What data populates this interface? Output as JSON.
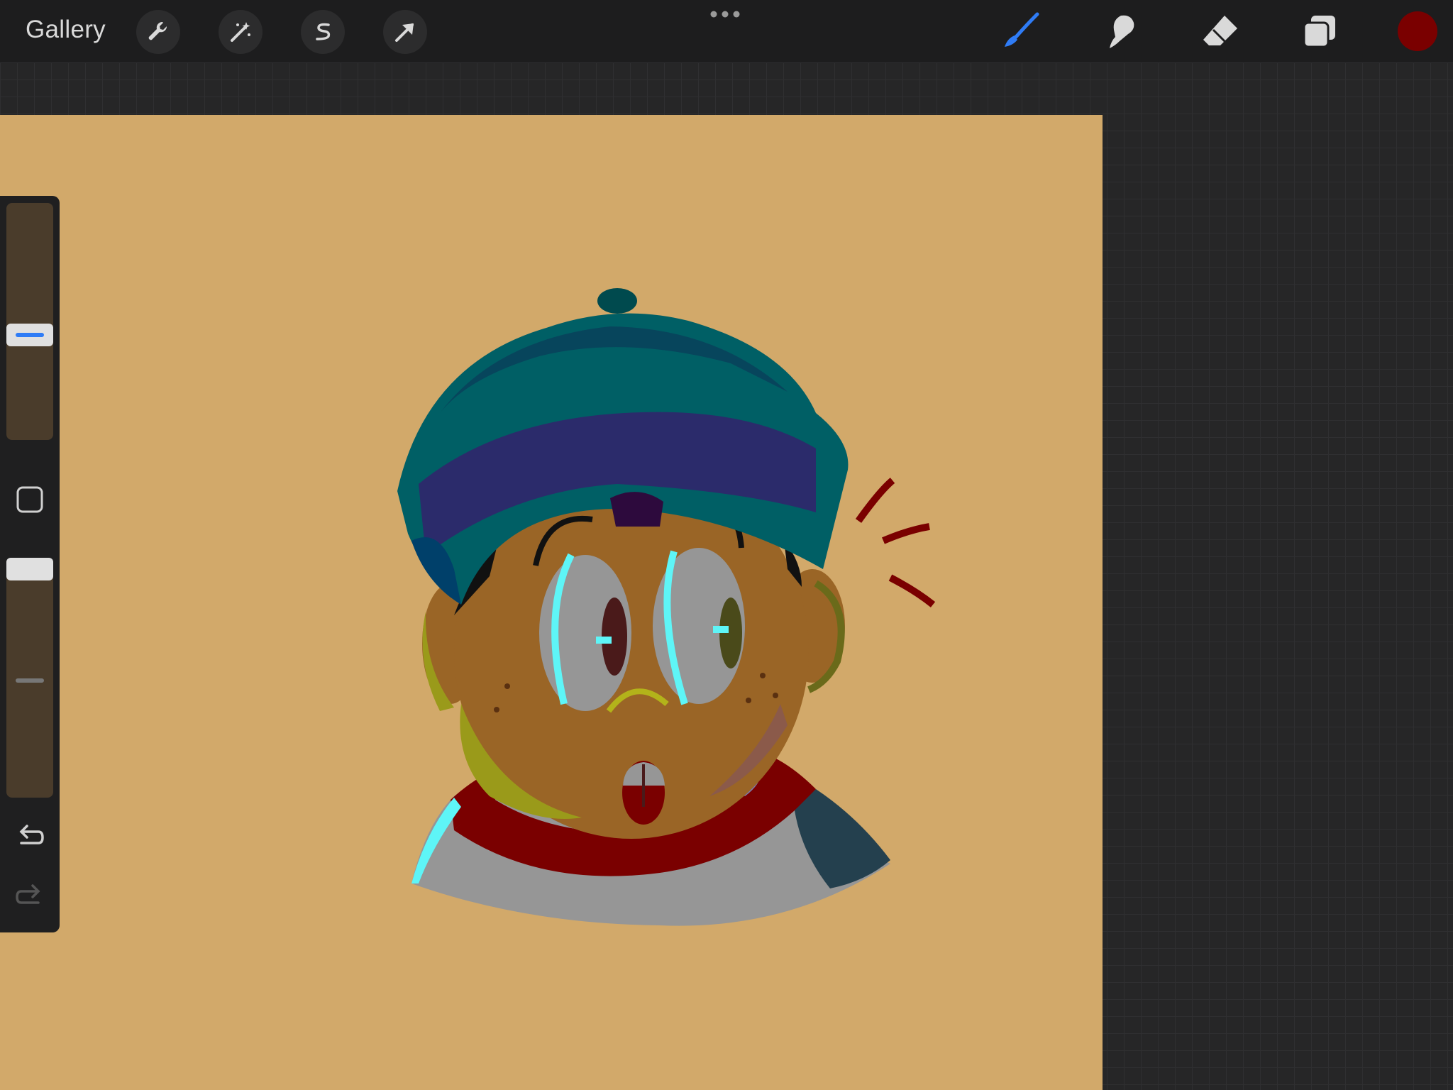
{
  "topbar": {
    "gallery_label": "Gallery",
    "left_tools": [
      "wrench-icon",
      "magic-wand-icon",
      "selection-s-icon",
      "transform-arrow-icon"
    ],
    "more_icon": "more-dots-icon",
    "right_tools": [
      "brush-icon",
      "smudge-icon",
      "eraser-icon",
      "layers-icon"
    ],
    "active_tool": "brush-icon",
    "active_color": "#7a0000",
    "accent_color": "#2f7cf6"
  },
  "sidebar": {
    "brush_size_level": 0.55,
    "opacity_level": 0.95,
    "modify_button": "square-icon",
    "undo": "undo-icon",
    "redo": "redo-icon"
  },
  "canvas": {
    "background_color": "#d2a96a",
    "artwork": "illustration-character-beanie"
  }
}
